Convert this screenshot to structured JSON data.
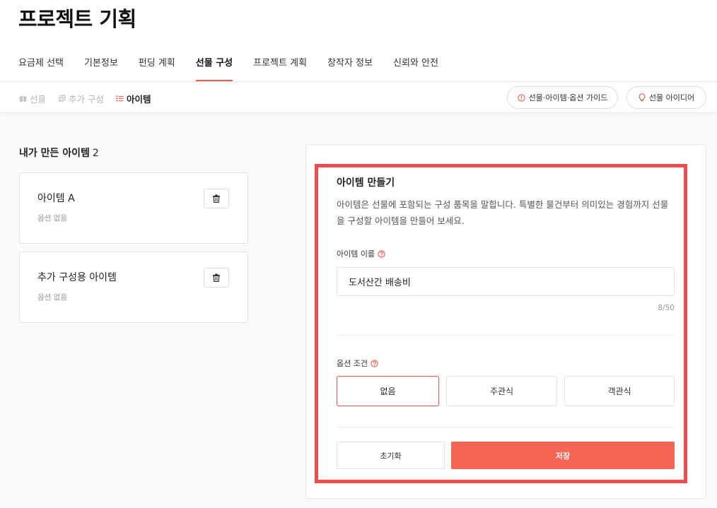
{
  "page": {
    "title": "프로젝트 기획"
  },
  "tabs": [
    {
      "label": "요금제 선택"
    },
    {
      "label": "기본정보"
    },
    {
      "label": "펀딩 계획"
    },
    {
      "label": "선물 구성"
    },
    {
      "label": "프로젝트 계획"
    },
    {
      "label": "창작자 정보"
    },
    {
      "label": "신뢰와 안전"
    }
  ],
  "active_tab": "선물 구성",
  "subnav": {
    "crumbs": [
      {
        "label": "선물",
        "icon": "gift-icon"
      },
      {
        "label": "추가 구성",
        "icon": "add-box-icon"
      },
      {
        "label": "아이템",
        "icon": "list-icon"
      }
    ],
    "guide_label": "선물·아이템·옵션 가이드",
    "idea_label": "선물 아이디어"
  },
  "my_items": {
    "title": "내가 만든 아이템",
    "count": "2",
    "items": [
      {
        "name": "아이템 A",
        "sub": "옵션 없음"
      },
      {
        "name": "추가 구성용 아이템",
        "sub": "옵션 없음"
      }
    ]
  },
  "form": {
    "title": "아이템 만들기",
    "description": "아이템은 선물에 포함되는 구성 품목을 말합니다. 특별한 물건부터 의미있는 경험까지 선물을 구성할 아이템을 만들어 보세요.",
    "name_label": "아이템 이름",
    "name_value": "도서산간 배송비",
    "char_count": "8/50",
    "option_label": "옵션 조건",
    "options": [
      {
        "label": "없음"
      },
      {
        "label": "주관식"
      },
      {
        "label": "객관식"
      }
    ],
    "selected_option": "없음",
    "reset_label": "초기화",
    "save_label": "저장"
  },
  "colors": {
    "accent": "#f05a4f",
    "save": "#f46555",
    "highlight": "#ee4d4f"
  }
}
